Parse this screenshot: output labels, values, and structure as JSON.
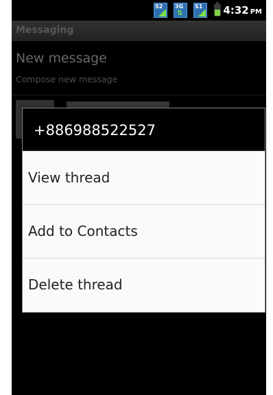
{
  "status_bar": {
    "sim1_tag": "S2",
    "network_tag": "3G",
    "sim2_tag": "S1",
    "time": "4:32",
    "ampm": "PM"
  },
  "app": {
    "title": "Messaging"
  },
  "list": {
    "new_message_title": "New message",
    "new_message_subtitle": "Compose new message"
  },
  "dialog": {
    "title": "+886988522527",
    "items": [
      {
        "label": "View thread"
      },
      {
        "label": "Add to Contacts"
      },
      {
        "label": "Delete thread"
      }
    ]
  }
}
